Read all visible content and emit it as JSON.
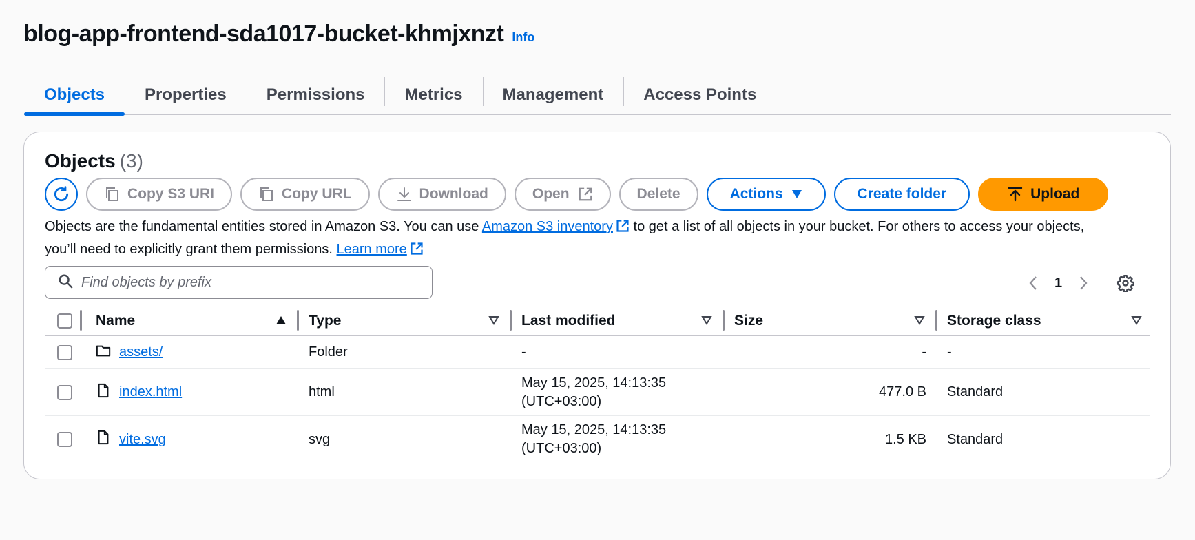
{
  "header": {
    "title": "blog-app-frontend-sda1017-bucket-khmjxnzt",
    "info_label": "Info"
  },
  "tabs": [
    {
      "label": "Objects",
      "active": true
    },
    {
      "label": "Properties",
      "active": false
    },
    {
      "label": "Permissions",
      "active": false
    },
    {
      "label": "Metrics",
      "active": false
    },
    {
      "label": "Management",
      "active": false
    },
    {
      "label": "Access Points",
      "active": false
    }
  ],
  "objects_panel": {
    "heading": "Objects",
    "count": "(3)",
    "toolbar": {
      "copy_s3_uri": "Copy S3 URI",
      "copy_url": "Copy URL",
      "download": "Download",
      "open": "Open",
      "delete": "Delete",
      "actions": "Actions",
      "create_folder": "Create folder",
      "upload": "Upload"
    },
    "description": {
      "part1": "Objects are the fundamental entities stored in Amazon S3. You can use ",
      "link1": "Amazon S3 inventory",
      "part2": " to get a list of all objects in your bucket. For others to access your objects, you’ll need to explicitly grant them permissions. ",
      "link2": "Learn more"
    },
    "search": {
      "placeholder": "Find objects by prefix"
    },
    "pagination": {
      "current_page": "1"
    },
    "table": {
      "columns": [
        "Name",
        "Type",
        "Last modified",
        "Size",
        "Storage class"
      ],
      "rows": [
        {
          "icon": "folder-icon",
          "name": "assets/",
          "type": "Folder",
          "last_modified_date": "-",
          "last_modified_tz": "",
          "size": "-",
          "storage_class": "-"
        },
        {
          "icon": "file-icon",
          "name": "index.html",
          "type": "html",
          "last_modified_date": "May 15, 2025, 14:13:35",
          "last_modified_tz": "(UTC+03:00)",
          "size": "477.0 B",
          "storage_class": "Standard"
        },
        {
          "icon": "file-icon",
          "name": "vite.svg",
          "type": "svg",
          "last_modified_date": "May 15, 2025, 14:13:35",
          "last_modified_tz": "(UTC+03:00)",
          "size": "1.5 KB",
          "storage_class": "Standard"
        }
      ]
    }
  },
  "colors": {
    "accent": "#006ce0",
    "primary_button": "#ff9900",
    "text": "#0f141a",
    "disabled": "#8c8c94"
  }
}
